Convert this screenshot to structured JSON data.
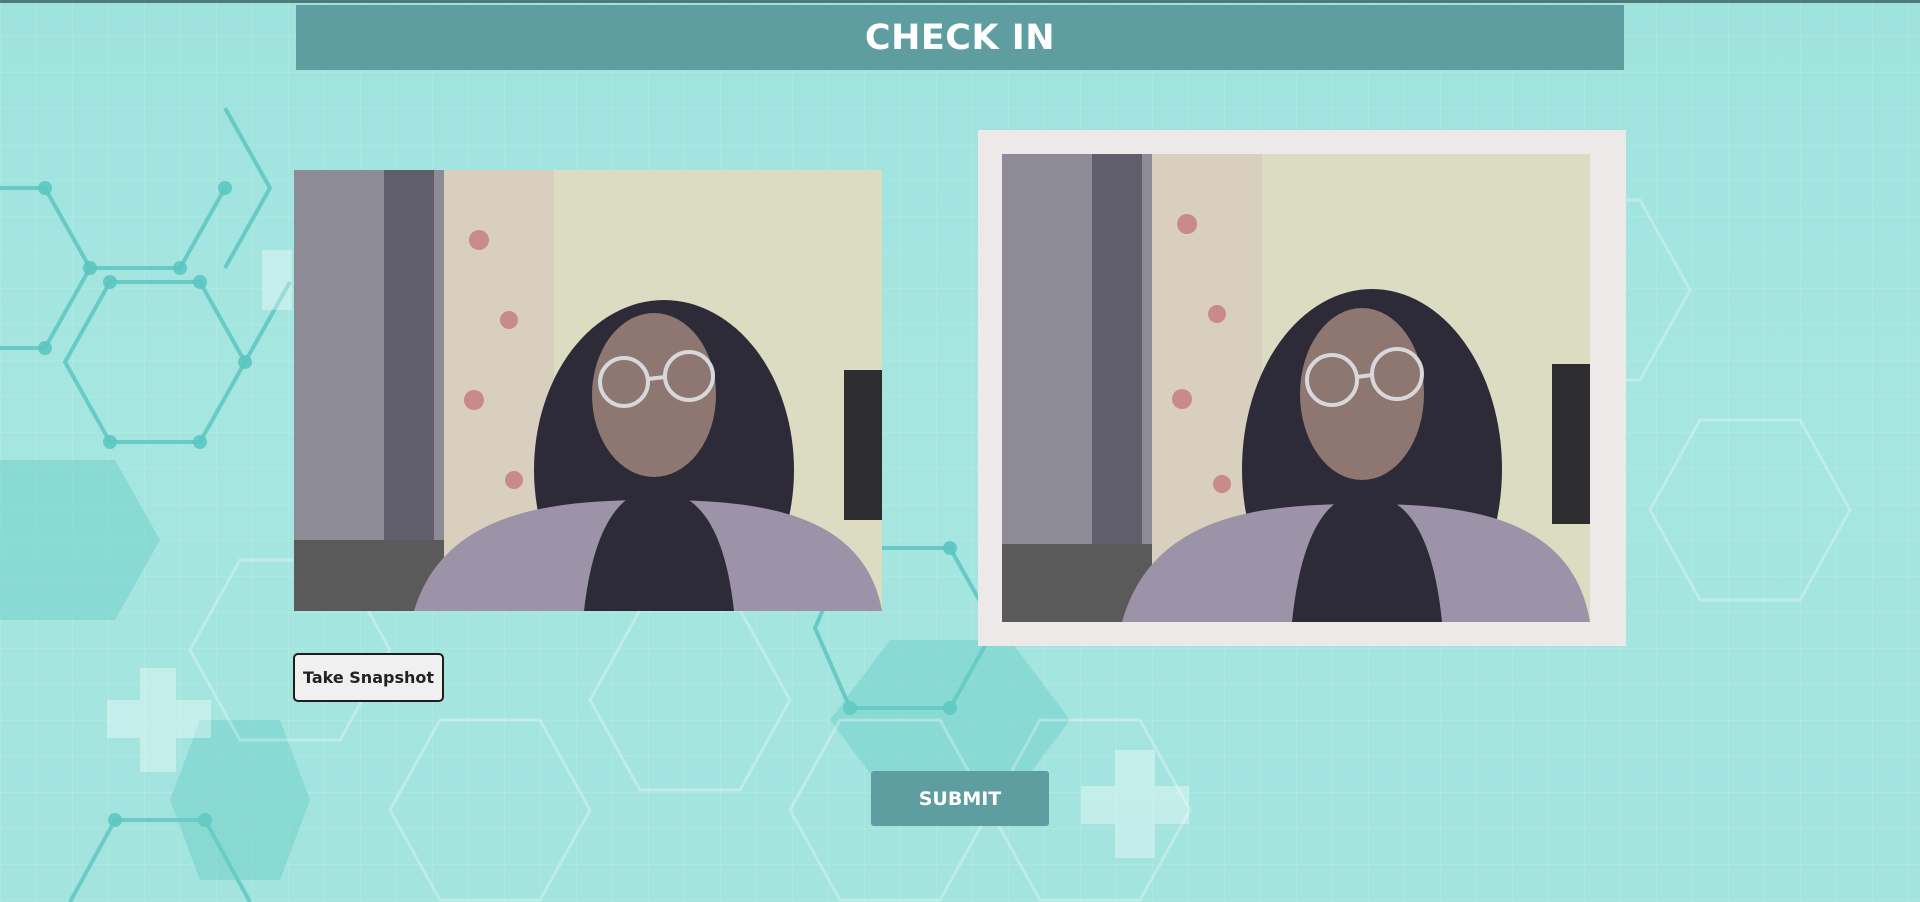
{
  "header": {
    "title": "CHECK IN"
  },
  "camera": {
    "icon": "webcam-feed"
  },
  "snapshot": {
    "icon": "captured-photo"
  },
  "actions": {
    "take_snapshot_label": "Take Snapshot",
    "submit_label": "SUBMIT"
  },
  "colors": {
    "accent": "#5f9ea0",
    "background": "#a4e4df",
    "frame": "#ece9e8",
    "button_light": "#f0f0f0"
  }
}
